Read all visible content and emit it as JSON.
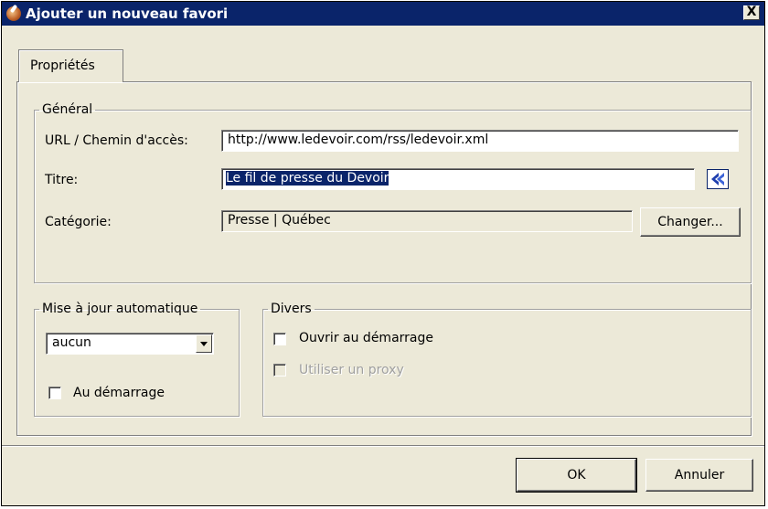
{
  "window": {
    "title": "Ajouter un nouveau favori",
    "close_label": "X"
  },
  "tabs": [
    {
      "label": "Propriétés",
      "active": true
    }
  ],
  "general": {
    "legend": "Général",
    "url_label": "URL / Chemin d'accès:",
    "url_value": "http://www.ledevoir.com/rss/ledevoir.xml",
    "title_label": "Titre:",
    "title_value": "Le fil de presse du Devoir",
    "category_label": "Catégorie:",
    "category_value": "Presse | Québec",
    "change_button": "Changer..."
  },
  "auto_update": {
    "legend": "Mise à jour automatique",
    "selected": "aucun",
    "on_startup_label": "Au démarrage",
    "on_startup_checked": false
  },
  "misc": {
    "legend": "Divers",
    "open_on_startup_label": "Ouvrir au démarrage",
    "open_on_startup_checked": false,
    "use_proxy_label": "Utiliser un proxy",
    "use_proxy_checked": false,
    "use_proxy_enabled": false
  },
  "footer": {
    "ok_label": "OK",
    "cancel_label": "Annuler"
  },
  "colors": {
    "titlebar": "#0a246a",
    "dialog_bg": "#ece9d8",
    "selection": "#0a246a"
  }
}
